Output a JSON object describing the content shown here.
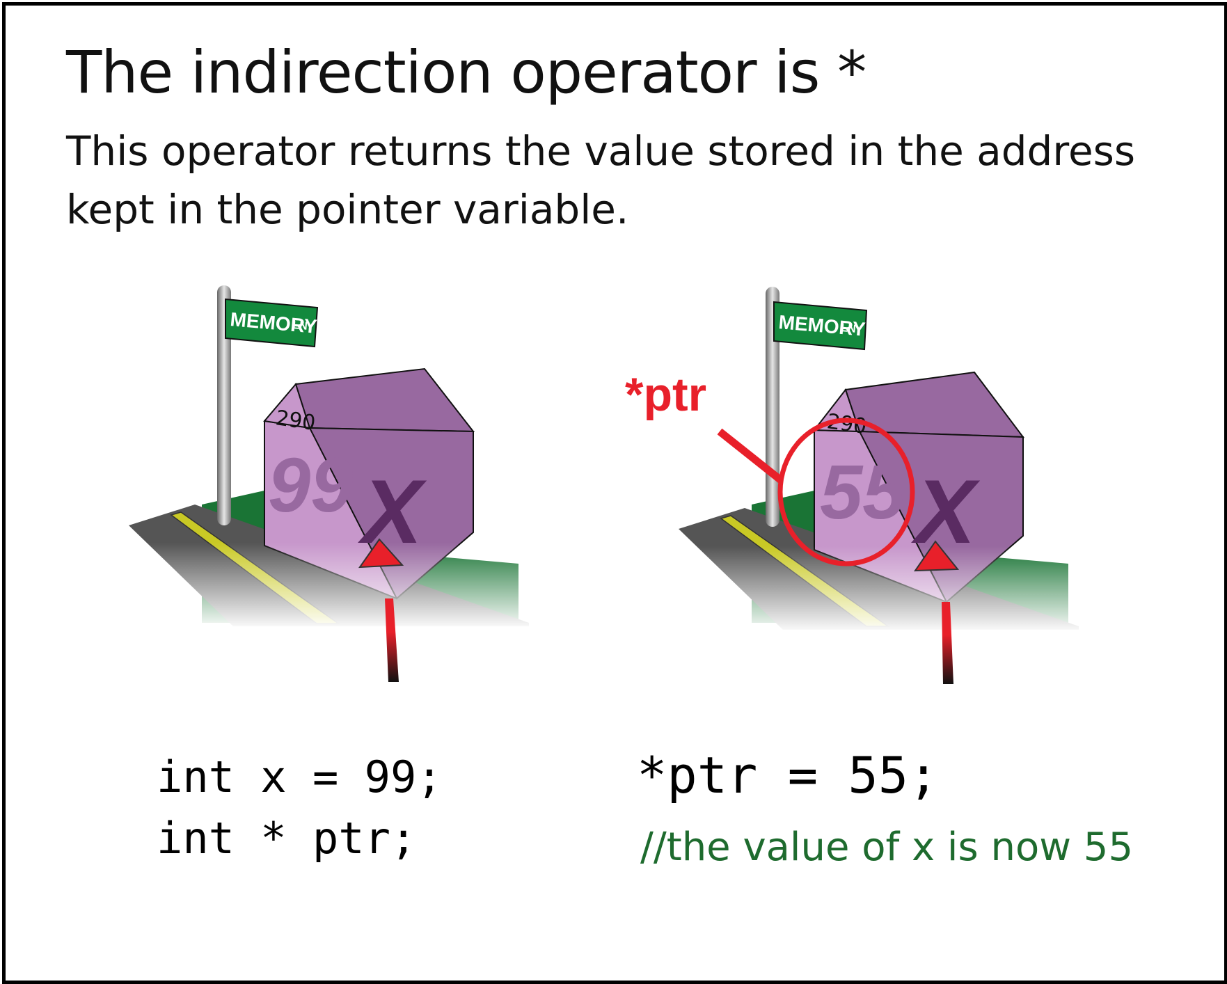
{
  "title": "The indirection operator is *",
  "subtitle": "This operator returns the value stored in the address kept in the pointer variable.",
  "scenes": [
    {
      "street_sign": {
        "main": "MEMORY",
        "suffix": "LN"
      },
      "house_number": "290",
      "house_value": "99",
      "house_label": "X",
      "code_lines": [
        "int x = 99;",
        "int * ptr;"
      ]
    },
    {
      "street_sign": {
        "main": "MEMORY",
        "suffix": "LN"
      },
      "house_number": "290",
      "house_value": "55",
      "house_label": "X",
      "pointer_label": "*ptr",
      "code_line": "*ptr = 55;",
      "comment": "//the value of x is now 55"
    }
  ],
  "colors": {
    "house_front": "#c797cb",
    "house_side": "#9869a0",
    "house_roof": "#9869a0",
    "house_value_text": "#9869a0",
    "house_label_text": "#5a2b62",
    "sign_green": "#13893d",
    "grass": "#1a7435",
    "road": "#555555",
    "road_stripe": "#c9c925",
    "arrow_red": "#e8202a",
    "comment_green": "#1e6b2e"
  }
}
